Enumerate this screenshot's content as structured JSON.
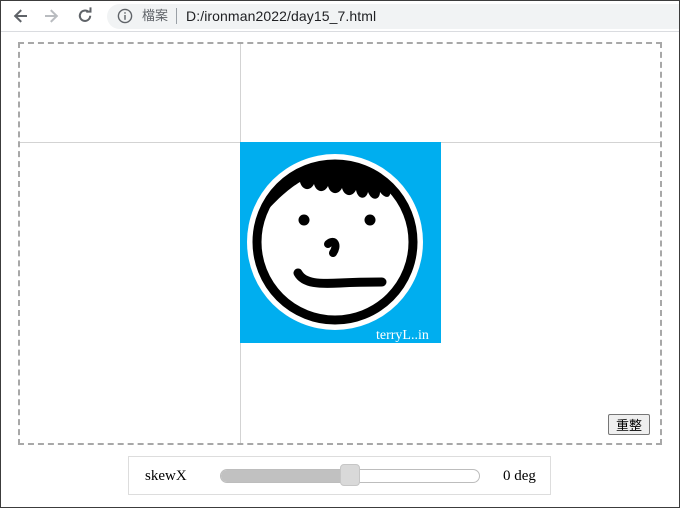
{
  "browser": {
    "site_label": "檔案",
    "url": "D:/ironman2022/day15_7.html"
  },
  "stage": {
    "reset_label": "重整",
    "avatar_watermark": "terryL..in"
  },
  "control": {
    "label": "skewX",
    "value": "0",
    "unit": "deg",
    "min": -90,
    "max": 90,
    "current": 0
  },
  "colors": {
    "avatar_bg": "#00aeef",
    "slider_fill": "#c1c1c1"
  },
  "icons": {
    "back": "back-arrow-icon",
    "forward": "forward-arrow-icon",
    "reload": "reload-icon",
    "info": "info-icon"
  }
}
